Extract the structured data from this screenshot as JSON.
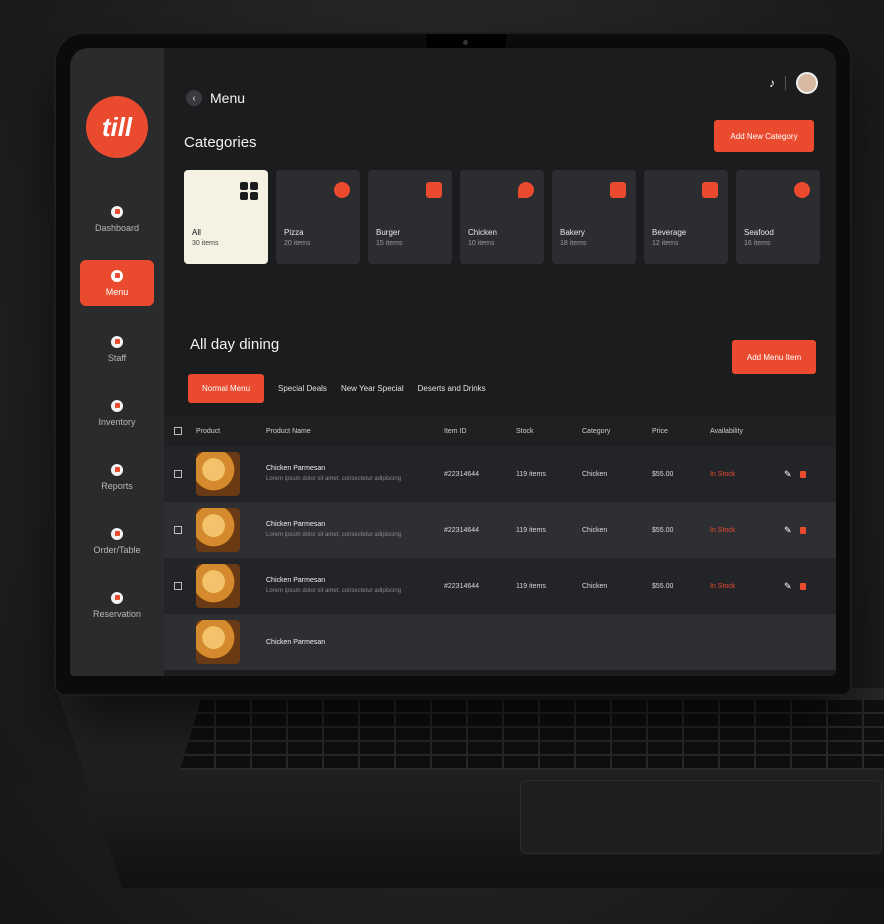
{
  "sidebar": {
    "logo": "till",
    "items": [
      {
        "label": "Dashboard",
        "icon": "grid-icon"
      },
      {
        "label": "Menu",
        "icon": "menu-icon",
        "active": true
      },
      {
        "label": "Staff",
        "icon": "staff-icon"
      },
      {
        "label": "Inventory",
        "icon": "inventory-icon"
      },
      {
        "label": "Reports",
        "icon": "reports-icon"
      },
      {
        "label": "Order/Table",
        "icon": "order-icon"
      },
      {
        "label": "Reservation",
        "icon": "reservation-icon"
      }
    ]
  },
  "header": {
    "back_icon": "‹",
    "title": "Menu",
    "bell_icon": "notification-bell-icon"
  },
  "categories": {
    "title": "Categories",
    "add_label": "Add New Category",
    "items": [
      {
        "name": "All",
        "count": "30 items",
        "active": true
      },
      {
        "name": "Pizza",
        "count": "20 items"
      },
      {
        "name": "Burger",
        "count": "15 items"
      },
      {
        "name": "Chicken",
        "count": "10 items"
      },
      {
        "name": "Bakery",
        "count": "18 items"
      },
      {
        "name": "Beverage",
        "count": "12 items"
      },
      {
        "name": "Seafood",
        "count": "16 items"
      }
    ]
  },
  "dining": {
    "title": "All day dining",
    "add_label": "Add Menu Item",
    "tabs": [
      "Normal Menu",
      "Special Deals",
      "New Year Special",
      "Deserts and Drinks"
    ]
  },
  "table": {
    "headers": [
      "Product",
      "Product Name",
      "Item ID",
      "Stock",
      "Category",
      "Price",
      "Availability"
    ],
    "rows": [
      {
        "name": "Chicken Parmesan",
        "desc": "Lorem ipsum dolor sit amet, consectetur adipiscing",
        "id": "#22314644",
        "stock": "119 items",
        "category": "Chicken",
        "price": "$55.00",
        "availability": "In Stock"
      },
      {
        "name": "Chicken Parmesan",
        "desc": "Lorem ipsum dolor sit amet, consectetur adipiscing",
        "id": "#22314644",
        "stock": "119 items",
        "category": "Chicken",
        "price": "$55.00",
        "availability": "In Stock"
      },
      {
        "name": "Chicken Parmesan",
        "desc": "Lorem ipsum dolor sit amet, consectetur adipiscing",
        "id": "#22314644",
        "stock": "119 items",
        "category": "Chicken",
        "price": "$55.00",
        "availability": "In Stock"
      },
      {
        "name": "Chicken Parmesan",
        "desc": "",
        "id": "",
        "stock": "",
        "category": "",
        "price": "",
        "availability": ""
      }
    ]
  },
  "colors": {
    "accent": "#ea4b2f",
    "background": "#1b1c1e",
    "sidebar": "#2a2b2d"
  }
}
